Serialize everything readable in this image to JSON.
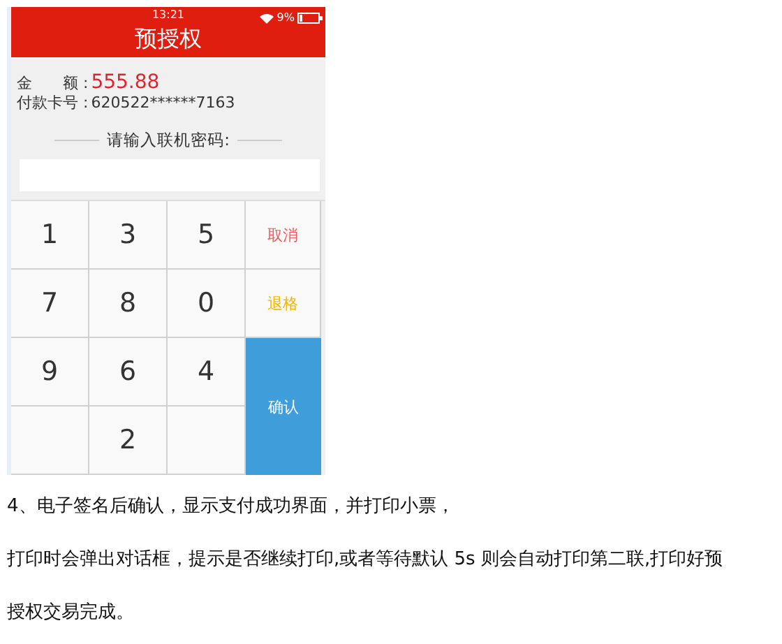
{
  "phone": {
    "status_bar": {
      "time": "13:21",
      "battery": "9%"
    },
    "title": "预授权",
    "amount_label": "金　　额 :",
    "amount": "555.88",
    "card_label": "付款卡号 :",
    "card_number": "620522******7163",
    "password_prompt": "请输入联机密码:",
    "keys": [
      {
        "kind": "digit",
        "label": "1"
      },
      {
        "kind": "digit",
        "label": "3"
      },
      {
        "kind": "digit",
        "label": "5"
      },
      {
        "kind": "cancel",
        "label": "取消"
      },
      {
        "kind": "digit",
        "label": "7"
      },
      {
        "kind": "digit",
        "label": "8"
      },
      {
        "kind": "digit",
        "label": "0"
      },
      {
        "kind": "backspace",
        "label": "退格"
      },
      {
        "kind": "digit",
        "label": "9"
      },
      {
        "kind": "digit",
        "label": "6"
      },
      {
        "kind": "digit",
        "label": "4"
      },
      {
        "kind": "confirm",
        "label": "确认"
      },
      {
        "kind": "blank"
      },
      {
        "kind": "digit",
        "label": "2"
      },
      {
        "kind": "blank"
      }
    ]
  },
  "paragraphs": [
    "4、电子签名后确认，显示支付成功界面，并打印小票，",
    "打印时会弹出对话框，提示是否继续打印,或者等待默认  5s  则会自动打印第二联,打印好预",
    "授权交易完成。"
  ]
}
